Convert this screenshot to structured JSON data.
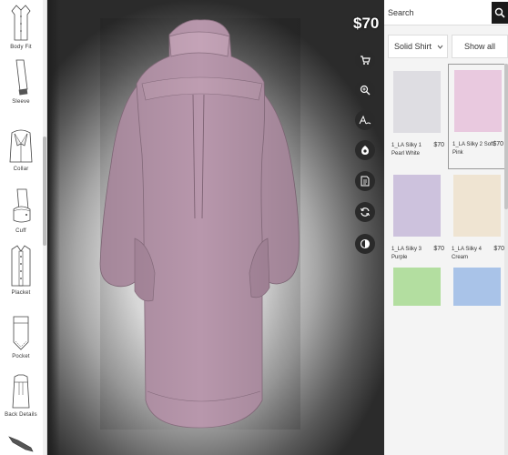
{
  "sidebar": {
    "items": [
      {
        "label": "Body Fit",
        "icon": "body-fit-icon"
      },
      {
        "label": "Sleeve",
        "icon": "sleeve-icon"
      },
      {
        "label": "Collar",
        "icon": "collar-icon"
      },
      {
        "label": "Cuff",
        "icon": "cuff-icon"
      },
      {
        "label": "Placket",
        "icon": "placket-icon"
      },
      {
        "label": "Pocket",
        "icon": "pocket-icon"
      },
      {
        "label": "Back Details",
        "icon": "back-details-icon"
      },
      {
        "label": "",
        "icon": "hem-icon"
      }
    ]
  },
  "stage": {
    "price": "$70",
    "shirt_color": "#b897ac",
    "tools": [
      "cart-icon",
      "zoom-icon",
      "monogram-icon",
      "fabric-icon",
      "summary-icon",
      "rotate-icon",
      "contrast-icon"
    ]
  },
  "panel": {
    "search": {
      "placeholder": "Search"
    },
    "filter": {
      "selected": "Solid Shirt"
    },
    "show_all": "Show all",
    "fabrics": [
      {
        "name": "1_LA Silky 1 Pearl White",
        "price": "$70",
        "color": "#dedde2",
        "selected": false
      },
      {
        "name": "1_LA Silky 2 Soft Pink",
        "price": "$70",
        "color": "#e9c9df",
        "selected": true
      },
      {
        "name": "1_LA Silky 3 Purple",
        "price": "$70",
        "color": "#cdc2dd",
        "selected": false
      },
      {
        "name": "1_LA Silky 4 Cream",
        "price": "$70",
        "color": "#efe4d2",
        "selected": false
      },
      {
        "name": "",
        "price": "",
        "color": "#b3dea0",
        "selected": false
      },
      {
        "name": "",
        "price": "",
        "color": "#a9c3e8",
        "selected": false
      }
    ]
  }
}
